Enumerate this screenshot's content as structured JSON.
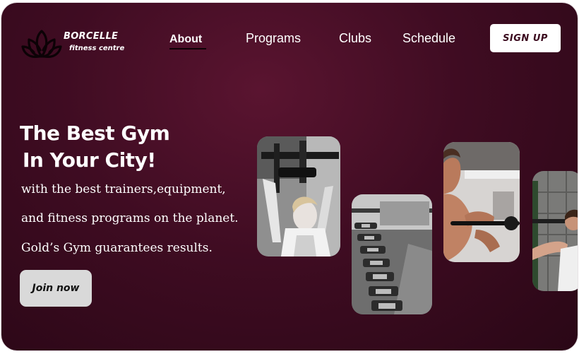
{
  "brand": {
    "name": "BORCELLE",
    "tagline": "fitness centre",
    "logo_icon": "lotus-icon"
  },
  "nav": {
    "items": [
      {
        "label": "About",
        "active": true
      },
      {
        "label": "Programs",
        "active": false
      },
      {
        "label": "Clubs",
        "active": false
      },
      {
        "label": "Schedule",
        "active": false
      }
    ],
    "signup_label": "SIGN UP"
  },
  "hero": {
    "headline_line1": "The Best Gym",
    "headline_line2": "In Your City!",
    "body_line1": "with  the best trainers,equipment,",
    "body_line2": "and fitness programs on the planet.",
    "body_line3": "Gold’s  Gym guarantees results.",
    "cta_label": "Join now"
  },
  "gallery": [
    {
      "subject": "woman-pull-down-photo"
    },
    {
      "subject": "dumbbell-rack-photo"
    },
    {
      "subject": "man-barbell-curl-photo"
    },
    {
      "subject": "woman-rope-training-photo"
    }
  ],
  "colors": {
    "background": "#3f0c22",
    "accent_text": "#3b0a1e",
    "button_light": "#d9d9d9"
  }
}
